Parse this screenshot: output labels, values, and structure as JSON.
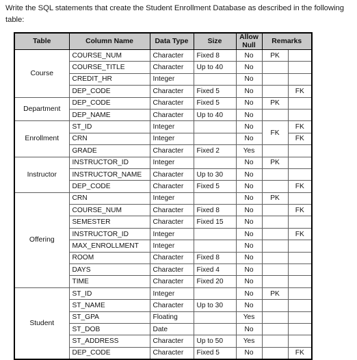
{
  "document": {
    "prompt": "Write the SQL statements that create the Student Enrollment Database as described in the following table:"
  },
  "spec_table": {
    "headers": {
      "table": "Table",
      "column_name": "Column Name",
      "data_type": "Data Type",
      "size": "Size",
      "allow_null_line1": "Allow",
      "allow_null_line2": "Null",
      "remarks": "Remarks"
    },
    "groups": [
      {
        "name": "Course",
        "rows": [
          {
            "column": "COURSE_NUM",
            "type": "Character",
            "size": "Fixed 8",
            "null": "No",
            "pk": "PK",
            "fk": ""
          },
          {
            "column": "COURSE_TITLE",
            "type": "Character",
            "size": "Up to 40",
            "null": "No",
            "pk": "",
            "fk": ""
          },
          {
            "column": "CREDIT_HR",
            "type": "Integer",
            "size": "",
            "null": "No",
            "pk": "",
            "fk": ""
          },
          {
            "column": "DEP_CODE",
            "type": "Character",
            "size": "Fixed 5",
            "null": "No",
            "pk": "",
            "fk": "FK"
          }
        ]
      },
      {
        "name": "Department",
        "rows": [
          {
            "column": "DEP_CODE",
            "type": "Character",
            "size": "Fixed 5",
            "null": "No",
            "pk": "PK",
            "fk": ""
          },
          {
            "column": "DEP_NAME",
            "type": "Character",
            "size": "Up to 40",
            "null": "No",
            "pk": "",
            "fk": ""
          }
        ]
      },
      {
        "name": "Enrollment",
        "merged_pk_label": "FK",
        "rows": [
          {
            "column": "ST_ID",
            "type": "Integer",
            "size": "",
            "null": "No",
            "pk": "FK",
            "fk": "FK"
          },
          {
            "column": "CRN",
            "type": "Integer",
            "size": "",
            "null": "No",
            "pk": "",
            "fk": "FK"
          },
          {
            "column": "GRADE",
            "type": "Character",
            "size": "Fixed 2",
            "null": "Yes",
            "pk": "",
            "fk": ""
          }
        ]
      },
      {
        "name": "Instructor",
        "rows": [
          {
            "column": "INSTRUCTOR_ID",
            "type": "Integer",
            "size": "",
            "null": "No",
            "pk": "PK",
            "fk": ""
          },
          {
            "column": "INSTRUCTOR_NAME",
            "type": "Character",
            "size": "Up to 30",
            "null": "No",
            "pk": "",
            "fk": ""
          },
          {
            "column": "DEP_CODE",
            "type": "Character",
            "size": "Fixed 5",
            "null": "No",
            "pk": "",
            "fk": "FK"
          }
        ]
      },
      {
        "name": "Offering",
        "rows": [
          {
            "column": "CRN",
            "type": "Integer",
            "size": "",
            "null": "No",
            "pk": "PK",
            "fk": ""
          },
          {
            "column": "COURSE_NUM",
            "type": "Character",
            "size": "Fixed 8",
            "null": "No",
            "pk": "",
            "fk": "FK"
          },
          {
            "column": "SEMESTER",
            "type": "Character",
            "size": "Fixed 15",
            "null": "No",
            "pk": "",
            "fk": ""
          },
          {
            "column": "INSTRUCTOR_ID",
            "type": "Integer",
            "size": "",
            "null": "No",
            "pk": "",
            "fk": "FK"
          },
          {
            "column": "MAX_ENROLLMENT",
            "type": "Integer",
            "size": "",
            "null": "No",
            "pk": "",
            "fk": ""
          },
          {
            "column": "ROOM",
            "type": "Character",
            "size": "Fixed 8",
            "null": "No",
            "pk": "",
            "fk": ""
          },
          {
            "column": "DAYS",
            "type": "Character",
            "size": "Fixed 4",
            "null": "No",
            "pk": "",
            "fk": ""
          },
          {
            "column": "TIME",
            "type": "Character",
            "size": "Fixed 20",
            "null": "No",
            "pk": "",
            "fk": ""
          }
        ]
      },
      {
        "name": "Student",
        "rows": [
          {
            "column": "ST_ID",
            "type": "Integer",
            "size": "",
            "null": "No",
            "pk": "PK",
            "fk": ""
          },
          {
            "column": "ST_NAME",
            "type": "Character",
            "size": "Up to 30",
            "null": "No",
            "pk": "",
            "fk": ""
          },
          {
            "column": "ST_GPA",
            "type": "Floating",
            "size": "",
            "null": "Yes",
            "pk": "",
            "fk": ""
          },
          {
            "column": "ST_DOB",
            "type": "Date",
            "size": "",
            "null": "No",
            "pk": "",
            "fk": ""
          },
          {
            "column": "ST_ADDRESS",
            "type": "Character",
            "size": "Up to 50",
            "null": "Yes",
            "pk": "",
            "fk": ""
          },
          {
            "column": "DEP_CODE",
            "type": "Character",
            "size": "Fixed 5",
            "null": "No",
            "pk": "",
            "fk": "FK"
          }
        ]
      }
    ]
  }
}
